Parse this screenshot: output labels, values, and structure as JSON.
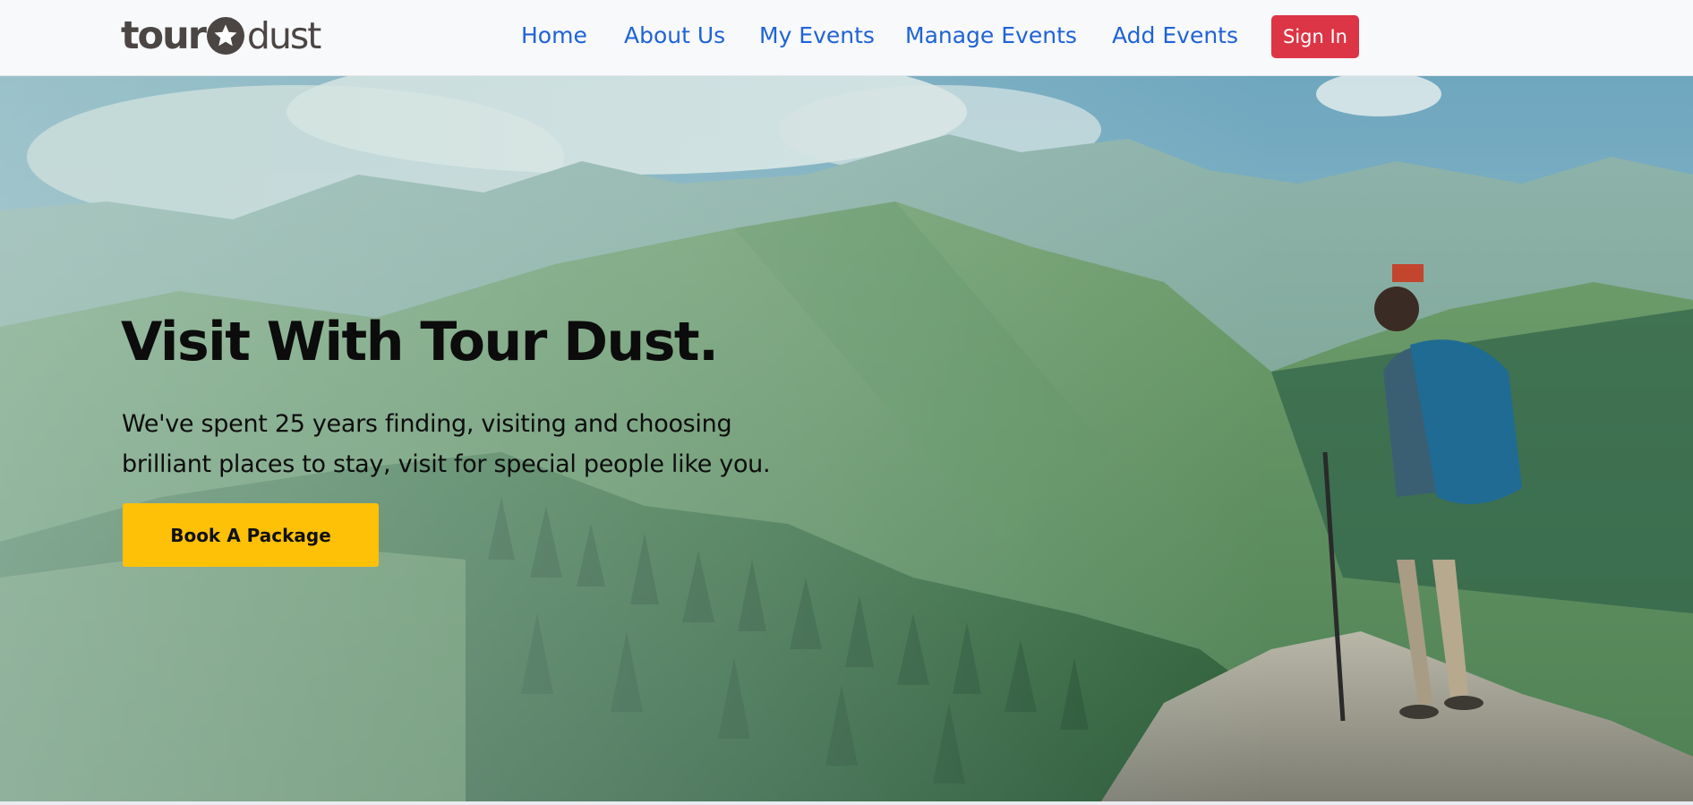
{
  "brand": {
    "logo_part_1": "tour",
    "logo_part_2": "dust"
  },
  "nav": {
    "items": [
      {
        "label": "Home"
      },
      {
        "label": "About Us"
      },
      {
        "label": "My Events"
      },
      {
        "label": "Manage Events"
      },
      {
        "label": "Add Events"
      }
    ],
    "sign_in_label": "Sign In"
  },
  "hero": {
    "title": "Visit With Tour Dust.",
    "text_line_1": "We've spent 25 years finding, visiting and choosing",
    "text_line_2": "brilliant places to stay, visit for special people like you.",
    "cta_label": "Book A Package"
  },
  "colors": {
    "nav_link": "#1f63d6",
    "sign_in_bg": "#dc3545",
    "cta_bg": "#ffc107",
    "navbar_bg": "#f8f9fb"
  },
  "icons": {
    "logo_star": "star-icon"
  }
}
